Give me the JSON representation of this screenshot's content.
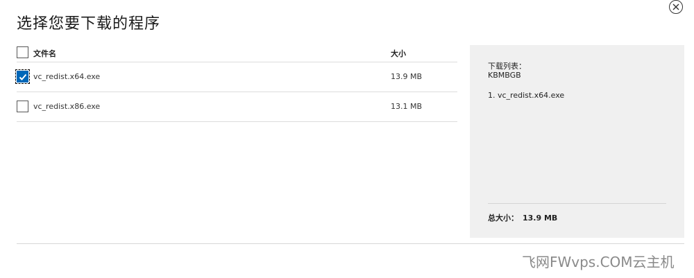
{
  "dialog": {
    "title": "选择您要下载的程序"
  },
  "table": {
    "headers": {
      "name": "文件名",
      "size": "大小"
    },
    "rows": [
      {
        "name": "vc_redist.x64.exe",
        "size": "13.9 MB",
        "checked": true
      },
      {
        "name": "vc_redist.x86.exe",
        "size": "13.1 MB",
        "checked": false
      }
    ]
  },
  "summary": {
    "heading": "下载列表：",
    "code": "KBMBGB",
    "items": [
      "1. vc_redist.x64.exe"
    ],
    "total_label": "总大小：",
    "total_value": "13.9 MB"
  },
  "watermark": "飞网FWvps.COM云主机",
  "colors": {
    "accent": "#0067b8",
    "panel_bg": "#f0f0f0",
    "divider": "#dcdcdc"
  }
}
